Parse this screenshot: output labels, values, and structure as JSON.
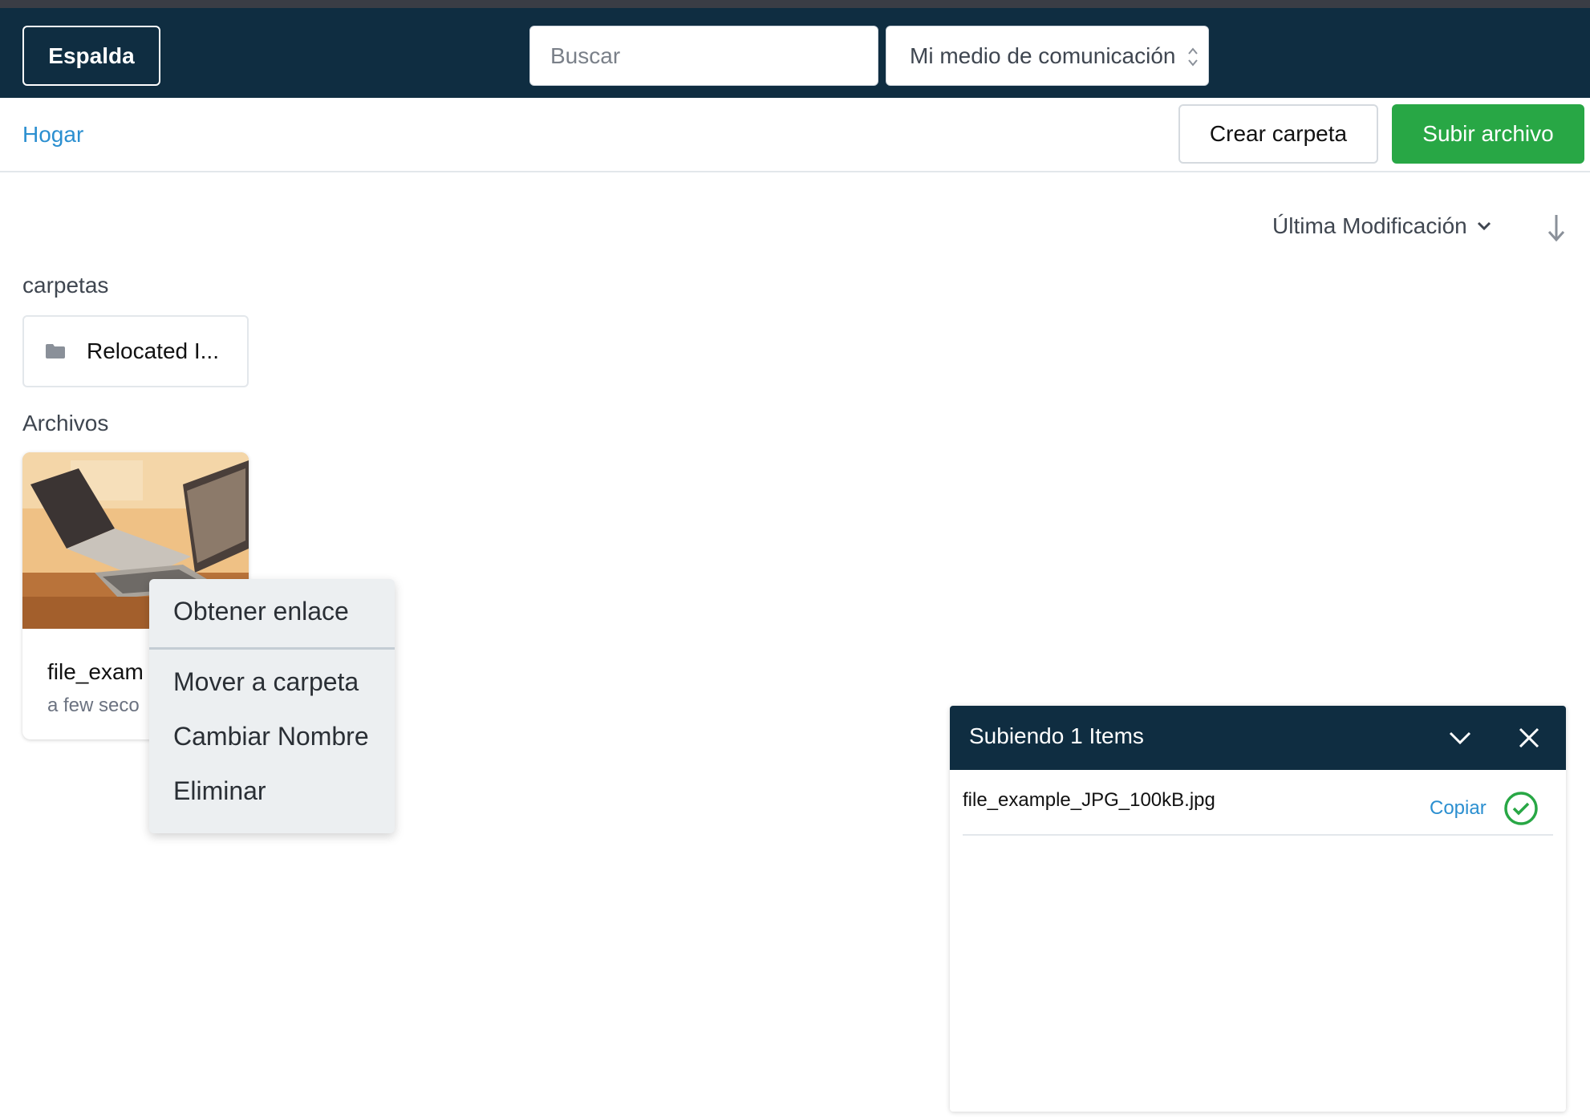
{
  "header": {
    "back_label": "Espalda",
    "search_placeholder": "Buscar",
    "media_select_value": "Mi medio de comunicación"
  },
  "toolbar": {
    "breadcrumb_home": "Hogar",
    "create_folder_label": "Crear carpeta",
    "upload_label": "Subir archivo"
  },
  "sort": {
    "label": "Última Modificación",
    "direction": "descending"
  },
  "folders": {
    "section_label": "carpetas",
    "items": [
      {
        "name": "Relocated I..."
      }
    ]
  },
  "files": {
    "section_label": "Archivos",
    "items": [
      {
        "name": "file_exam",
        "time": "a few seco"
      }
    ]
  },
  "context_menu": {
    "items": [
      "Obtener enlace",
      "Mover a carpeta",
      "Cambiar Nombre",
      "Eliminar"
    ]
  },
  "upload_panel": {
    "title": "Subiendo 1 Items",
    "items": [
      {
        "file_name": "file_example_JPG_100kB.jpg",
        "action_label": "Copiar",
        "status": "complete"
      }
    ]
  },
  "colors": {
    "header_bg": "#0f2d41",
    "accent_green": "#28a745",
    "link_blue": "#2b8fd0",
    "menu_bg": "#eceff1"
  },
  "icons": [
    "folder-icon",
    "select-arrows-icon",
    "chevron-down-icon",
    "arrow-down-icon",
    "close-icon",
    "check-circle-icon"
  ]
}
